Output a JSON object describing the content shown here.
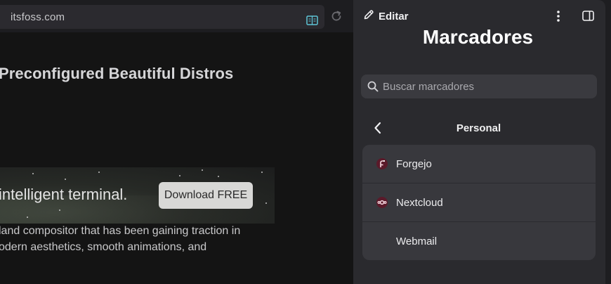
{
  "browser": {
    "url": "itsfoss.com",
    "headline": "Preconfigured Beautiful Distros",
    "ad": {
      "text": "intelligent terminal.",
      "button_label": "Download FREE"
    },
    "body_lines": [
      "land compositor that has been gaining traction in",
      "odern aesthetics, smooth animations, and"
    ]
  },
  "sidebar": {
    "edit_label": "Editar",
    "title": "Marcadores",
    "search": {
      "placeholder": "Buscar marcadores",
      "value": ""
    },
    "folder": "Personal",
    "items": [
      {
        "label": "Forgejo",
        "icon": "forgejo-icon"
      },
      {
        "label": "Nextcloud",
        "icon": "nextcloud-icon"
      },
      {
        "label": "Webmail",
        "icon": ""
      }
    ]
  },
  "colors": {
    "accent": "#5ec4d6",
    "favicon_bg": "#5a1a2a"
  }
}
